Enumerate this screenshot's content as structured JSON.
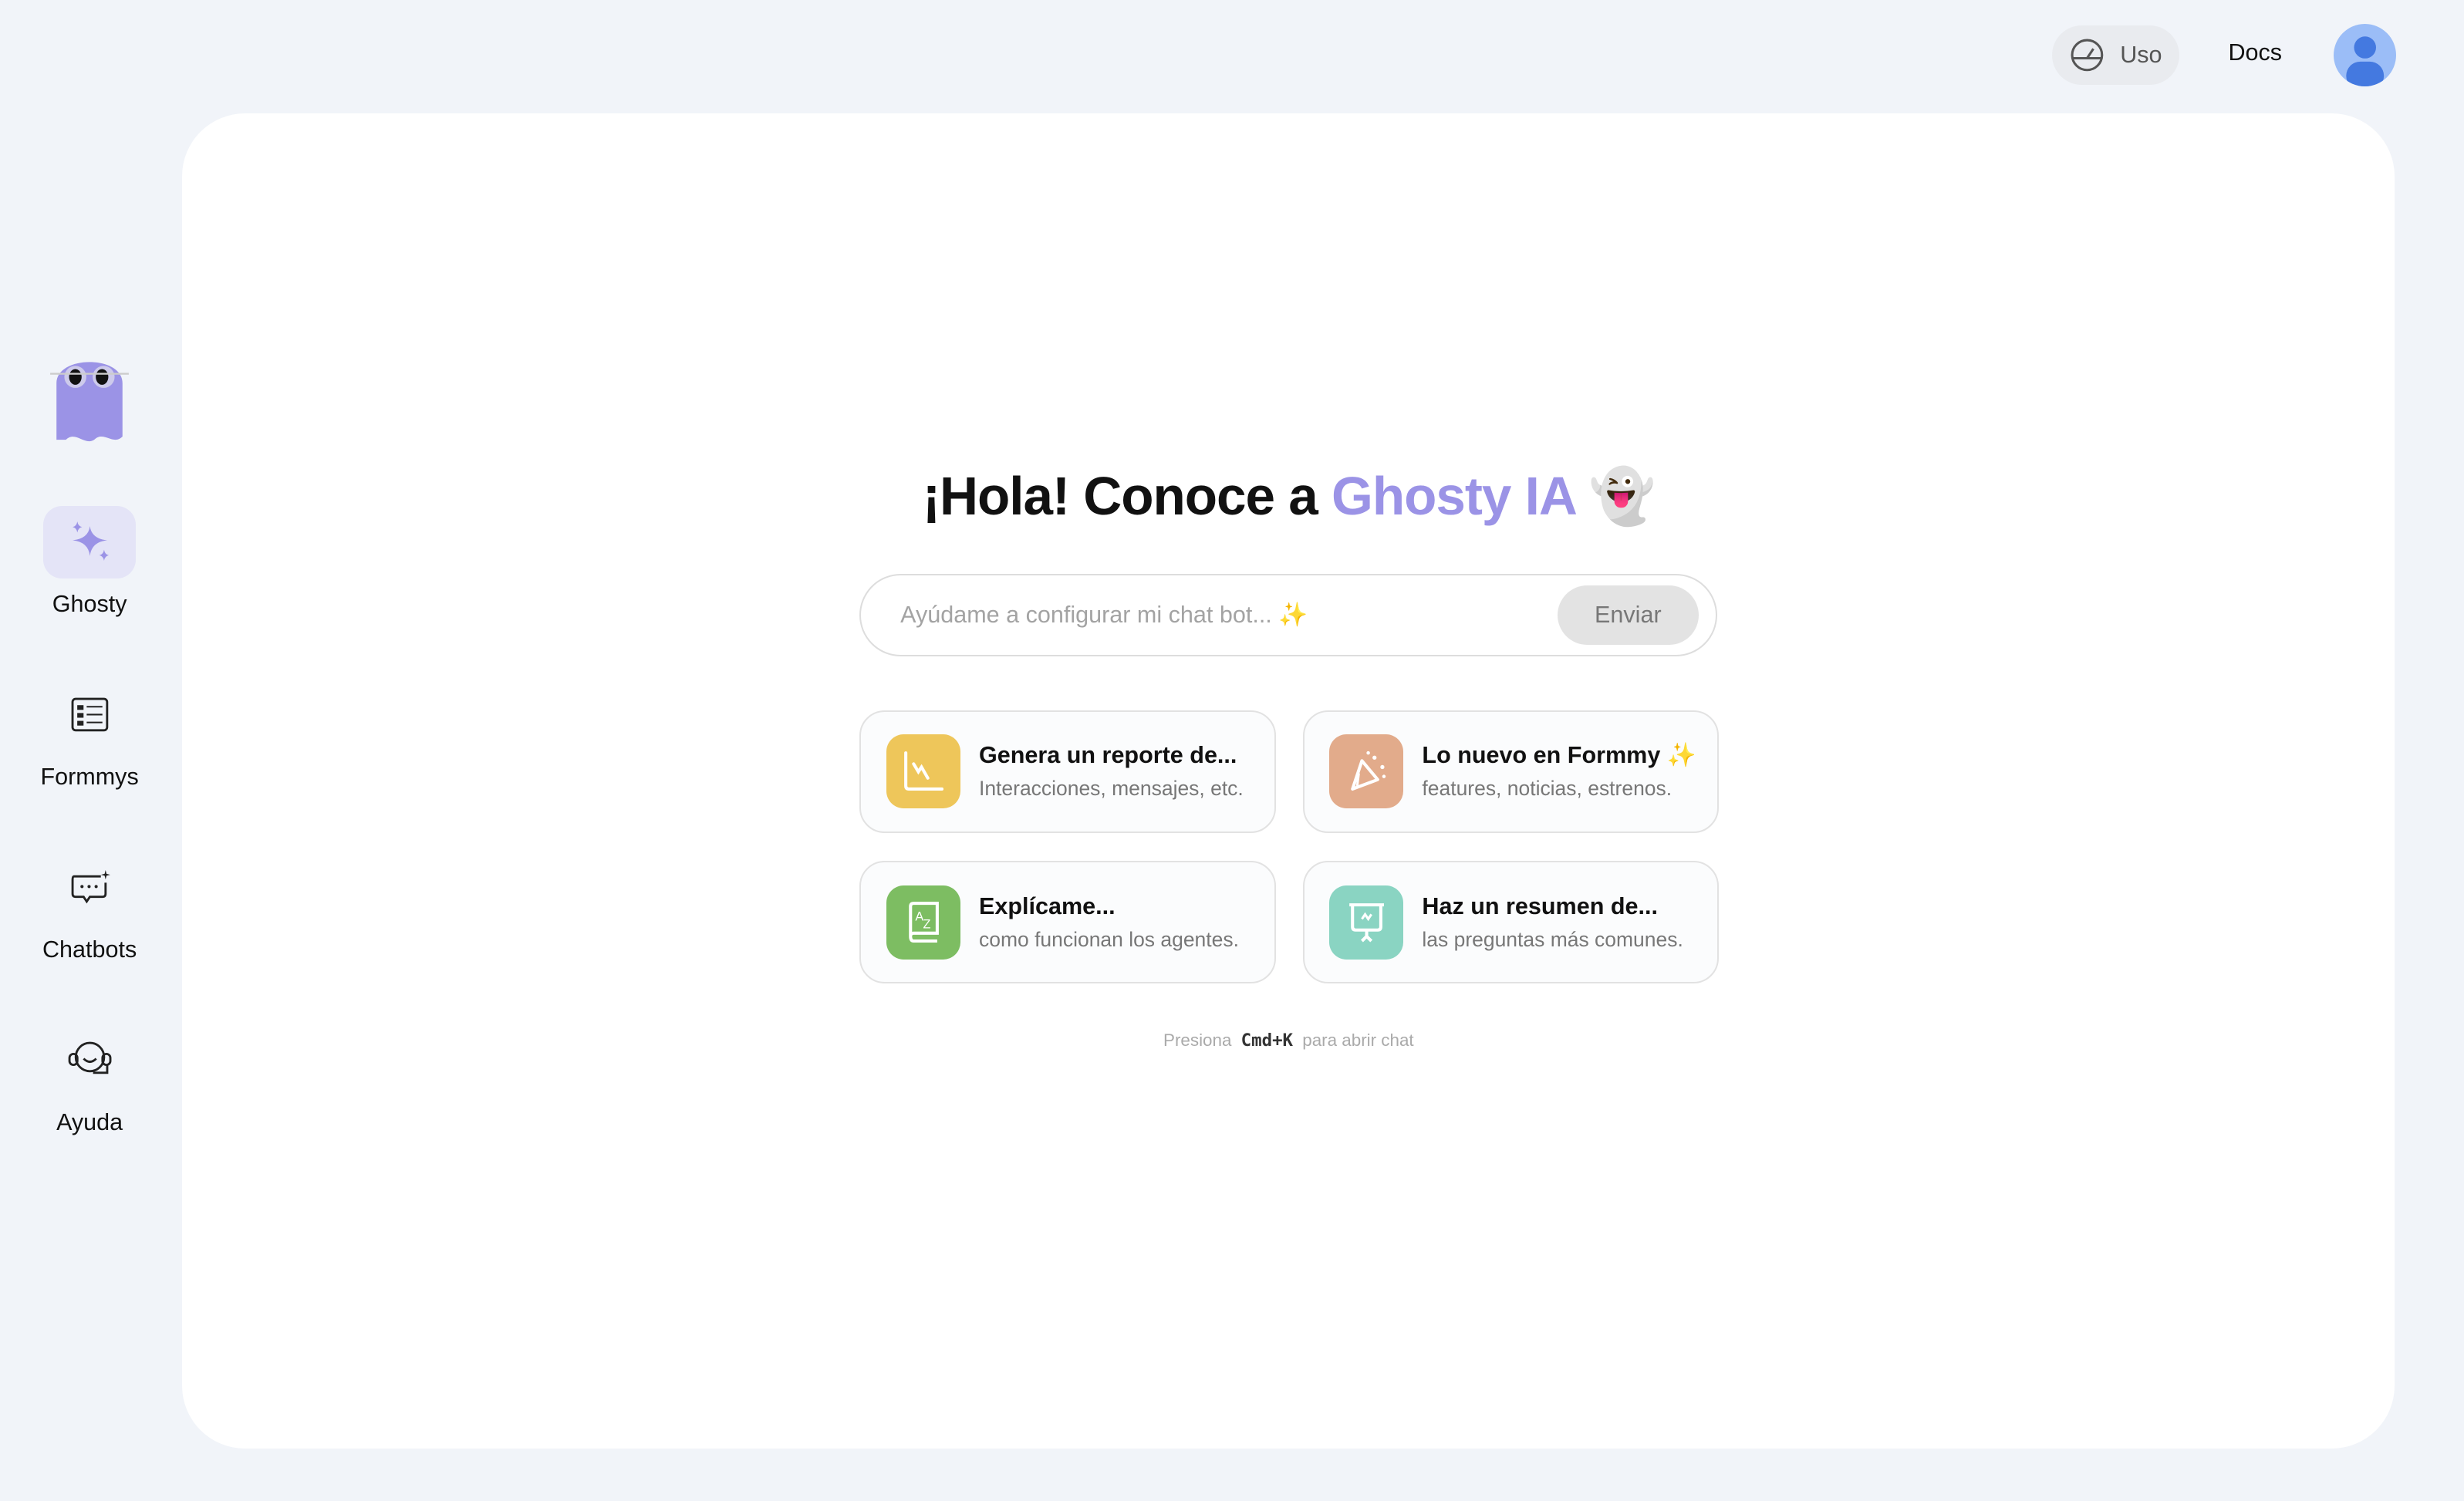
{
  "topbar": {
    "usage_label": "Uso",
    "docs_label": "Docs"
  },
  "sidebar": {
    "items": [
      {
        "label": "Ghosty",
        "active": true
      },
      {
        "label": "Formmys"
      },
      {
        "label": "Chatbots"
      },
      {
        "label": "Ayuda"
      }
    ]
  },
  "main": {
    "heading_prefix": "¡Hola! Conoce a ",
    "heading_brand": "Ghosty IA",
    "heading_emoji": "👻",
    "input_placeholder": "Ayúdame a configurar mi chat bot... ✨",
    "send_label": "Enviar",
    "suggestions": [
      {
        "title": "Genera un reporte de...",
        "subtitle": "Interacciones, mensajes, etc.",
        "icon": "chart-icon",
        "color": "#eec65a"
      },
      {
        "title": "Lo nuevo en Formmy ✨",
        "subtitle": "features, noticias, estrenos.",
        "icon": "party-icon",
        "color": "#e2ab8b"
      },
      {
        "title": "Explícame...",
        "subtitle": "como funcionan los agentes.",
        "icon": "dictionary-icon",
        "color": "#7dbd62"
      },
      {
        "title": "Haz un resumen de...",
        "subtitle": "las preguntas más comunes.",
        "icon": "presentation-icon",
        "color": "#8ad4c2"
      }
    ],
    "hint_prefix": "Presiona",
    "hint_key": "Cmd+K",
    "hint_suffix": "para abrir chat"
  },
  "colors": {
    "accent": "#9b93e6",
    "background": "#f1f4f9"
  }
}
